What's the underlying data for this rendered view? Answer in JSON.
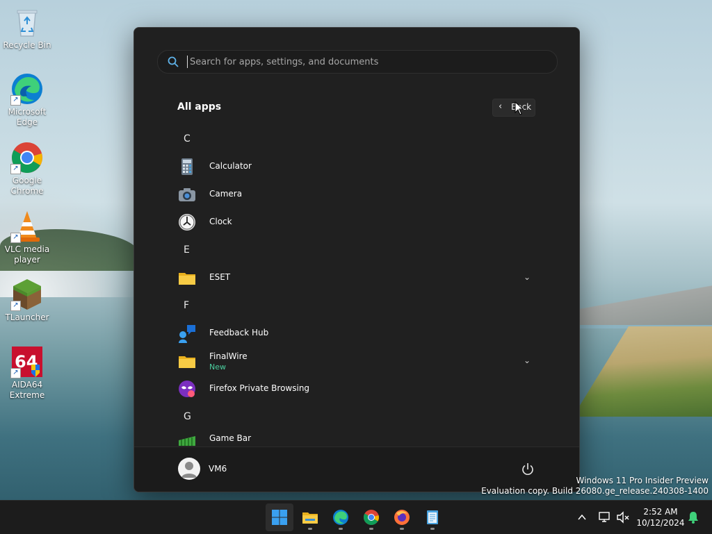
{
  "desktop": {
    "icons": [
      {
        "label": "Recycle Bin"
      },
      {
        "label": "Microsoft Edge"
      },
      {
        "label": "Google Chrome"
      },
      {
        "label": "VLC media player"
      },
      {
        "label": "TLauncher"
      },
      {
        "label": "AIDA64 Extreme"
      }
    ],
    "watermark": {
      "line1": "Windows 11 Pro Insider Preview",
      "line2": "Evaluation copy. Build 26080.ge_release.240308-1400"
    }
  },
  "start_menu": {
    "search": {
      "placeholder": "Search for apps, settings, and documents",
      "value": ""
    },
    "title": "All apps",
    "back_label": "Back",
    "sections": [
      {
        "letter": "C",
        "apps": [
          {
            "name": "Calculator",
            "icon": "calculator-icon"
          },
          {
            "name": "Camera",
            "icon": "camera-icon"
          },
          {
            "name": "Clock",
            "icon": "clock-icon"
          }
        ]
      },
      {
        "letter": "E",
        "apps": [
          {
            "name": "ESET",
            "icon": "folder-icon",
            "expandable": true
          }
        ]
      },
      {
        "letter": "F",
        "apps": [
          {
            "name": "Feedback Hub",
            "icon": "feedback-hub-icon"
          },
          {
            "name": "FinalWire",
            "icon": "folder-icon",
            "expandable": true,
            "badge": "New"
          },
          {
            "name": "Firefox Private Browsing",
            "icon": "firefox-private-icon"
          }
        ]
      },
      {
        "letter": "G",
        "apps": [
          {
            "name": "Game Bar",
            "icon": "game-bar-icon"
          }
        ]
      }
    ],
    "user": {
      "name": "VM6"
    }
  },
  "taskbar": {
    "apps": [
      {
        "name": "Start",
        "icon": "windows-logo-icon",
        "active": true
      },
      {
        "name": "File Explorer",
        "icon": "file-explorer-icon"
      },
      {
        "name": "Microsoft Edge",
        "icon": "edge-icon"
      },
      {
        "name": "Google Chrome",
        "icon": "chrome-icon"
      },
      {
        "name": "Firefox",
        "icon": "firefox-icon"
      },
      {
        "name": "Notepad",
        "icon": "notepad-icon"
      }
    ],
    "clock": {
      "time": "2:52 AM",
      "date": "10/12/2024"
    }
  },
  "colors": {
    "accent": "#0078d4",
    "new_badge": "#4bd0a0",
    "menu_bg": "#202020",
    "taskbar_bg": "#1c1c1c"
  }
}
